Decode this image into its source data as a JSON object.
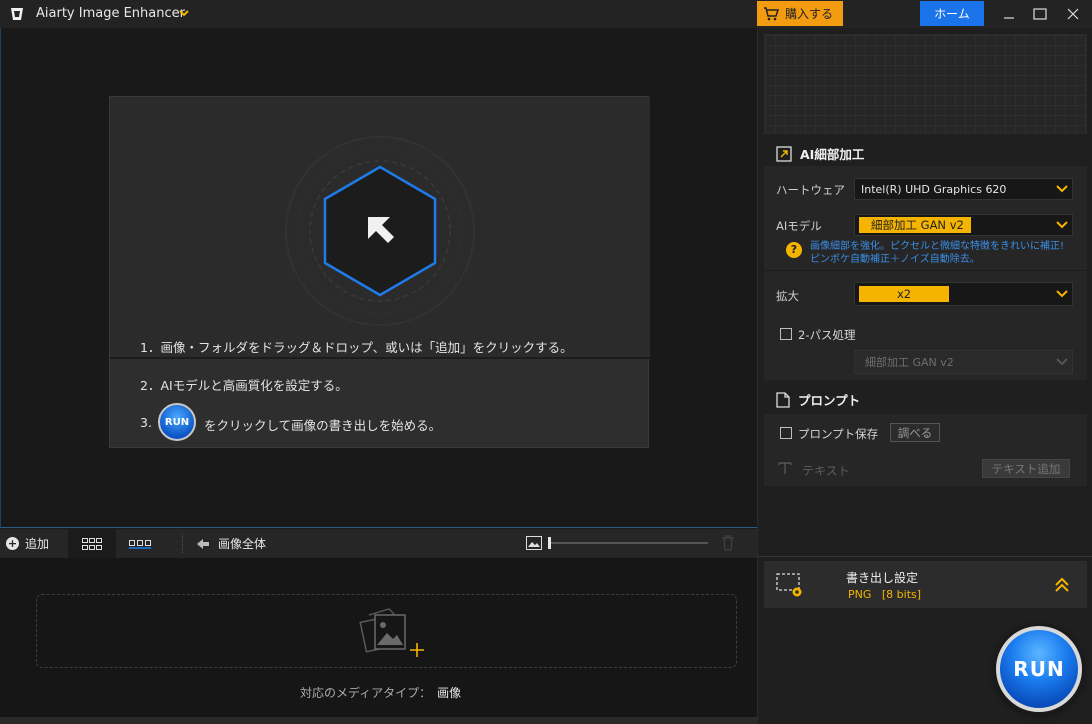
{
  "app": {
    "title": "Aiarty Image Enhancer"
  },
  "header": {
    "buy_label": "購入する",
    "home_label": "ホーム"
  },
  "steps": {
    "step1": "1．画像・フォルダをドラッグ＆ドロップ、或いは「追加」をクリックする。",
    "step2": "2．AIモデルと高画質化を設定する。",
    "step3_num": "3.",
    "step3_run": "RUN",
    "step3_text": "をクリックして画像の書き出しを始める。"
  },
  "toolbar": {
    "add_label": "追加",
    "full_image_label": "画像全体",
    "zoom_level": 0
  },
  "dropzone": {
    "media_type_label": "対応のメディアタイプ：",
    "media_type_value": "画像"
  },
  "panel": {
    "section_ai": "AI細部加工",
    "hardware_label": "ハートウェア",
    "hardware_value": "Intel(R) UHD Graphics 620",
    "ai_model_label": "AIモデル",
    "ai_model_value": "細部加工 GAN v2",
    "help_line1": "画像細部を強化。ピクセルと微細な特徴をきれいに補正!",
    "help_line2": "ピンボケ自動補正＋ノイズ自動除去。",
    "scale_label": "拡大",
    "scale_value": "x2",
    "two_pass_label": "2-パス処理",
    "two_pass_checked": false,
    "two_pass_model": "細部加工 GAN v2",
    "section_prompt": "プロンプト",
    "prompt_save_label": "プロンプト保存",
    "prompt_save_checked": false,
    "browse_label": "調べる",
    "text_label": "テキスト",
    "text_add_label": "テキスト追加"
  },
  "export": {
    "title": "書き出し設定",
    "format": "PNG",
    "bits": "[8 bits]",
    "run_label": "RUN"
  },
  "colors": {
    "accent_orange": "#f5b400",
    "buy_orange": "#f39c12",
    "home_blue": "#1a73e8",
    "hex_blue": "#1e7be8",
    "help_text_blue": "#3b8ee8"
  }
}
